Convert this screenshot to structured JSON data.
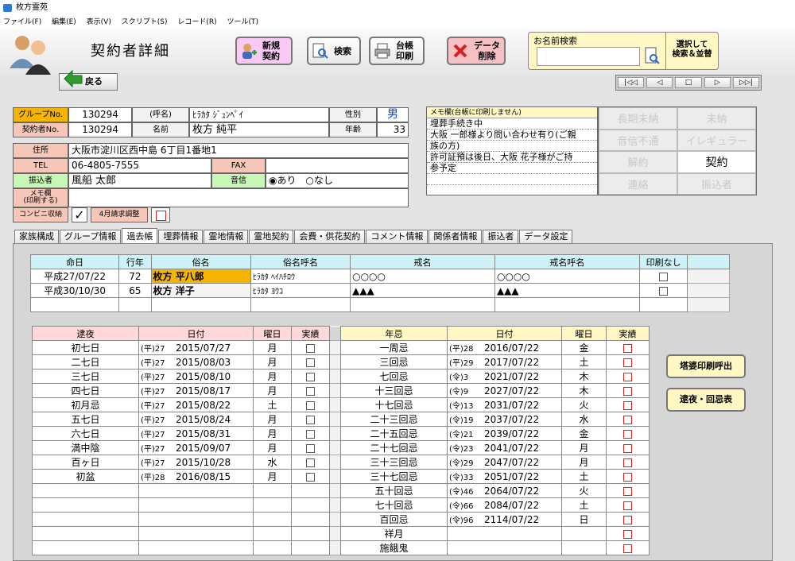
{
  "window": {
    "title": "枚方霊苑"
  },
  "menu": [
    "ファイル(F)",
    "編集(E)",
    "表示(V)",
    "スクリプト(S)",
    "レコード(R)",
    "ツール(T)"
  ],
  "page": {
    "title": "契約者詳細"
  },
  "toolbar": {
    "new_contract": [
      "新規",
      "契約"
    ],
    "search": "検索",
    "ledger_print": [
      "台帳",
      "印刷"
    ],
    "data_delete": [
      "データ",
      "削除"
    ],
    "name_search_label": "お名前検索",
    "name_search_value": "",
    "select_sort": [
      "選択して",
      "検索＆並替"
    ],
    "back": "戻る"
  },
  "contract": {
    "group_label": "グループNo.",
    "group_no": "130294",
    "contract_label": "契約者No.",
    "contract_no": "130294",
    "yomi_label": "(呼名)",
    "yomi": "ﾋﾗｶﾀ ｼﾞｭﾝﾍﾟｲ",
    "name_label": "名前",
    "name": "枚方 純平",
    "gender_label": "性別",
    "gender": "男",
    "age_label": "年齢",
    "age": "33",
    "address_label": "住所",
    "address": "大阪市淀川区西中島 6丁目1番地1",
    "tel_label": "TEL",
    "tel": "06-4805-7555",
    "fax_label": "FAX",
    "fax": "",
    "transfer_label": "振込者",
    "transfer": "風船 太郎",
    "notice_label": "音信",
    "notice_yes": "あり",
    "notice_no": "なし",
    "memo_label": [
      "メモ欄",
      "(印刷する)"
    ],
    "conv_label": "コンビニ収納",
    "april_label": "4月請求調整"
  },
  "memo": {
    "header": "メモ欄(台帳に印刷しません)",
    "lines": [
      "埋葬手続き中",
      "大阪 一郎様より問い合わせ有り(ご親",
      "族の方)",
      "許可証預は後日、大阪 花子様がご持",
      "参予定",
      ""
    ]
  },
  "status": [
    {
      "label": "長期未納",
      "on": false
    },
    {
      "label": "未納",
      "on": false
    },
    {
      "label": "音信不通",
      "on": false
    },
    {
      "label": "イレギュラー",
      "on": false
    },
    {
      "label": "解約",
      "on": false
    },
    {
      "label": "契約",
      "on": true
    },
    {
      "label": "連絡",
      "on": false
    },
    {
      "label": "振込者",
      "on": false
    }
  ],
  "tabs": [
    {
      "label": "家族構成",
      "active": false
    },
    {
      "label": "グループ情報",
      "active": false
    },
    {
      "label": "過去帳",
      "active": true
    },
    {
      "label": "埋葬情報",
      "active": false
    },
    {
      "label": "霊地情報",
      "active": false
    },
    {
      "label": "霊地契約",
      "active": false
    },
    {
      "label": "会費・供花契約",
      "active": false
    },
    {
      "label": "コメント情報",
      "active": false
    },
    {
      "label": "関係者情報",
      "active": false
    },
    {
      "label": "振込者",
      "active": false
    },
    {
      "label": "データ設定",
      "active": false
    }
  ],
  "deceased": {
    "headers": [
      "命日",
      "行年",
      "俗名",
      "俗名呼名",
      "戒名",
      "戒名呼名",
      "印刷なし"
    ],
    "rows": [
      [
        "平成27/07/22",
        "72",
        "枚方 平八郎",
        "ﾋﾗｶﾀ ﾍｲﾊﾁﾛｳ",
        "○○○○",
        "○○○○"
      ],
      [
        "平成30/10/30",
        "65",
        "枚方 洋子",
        "ﾋﾗｶﾀ ﾖｳｺ",
        "▲▲▲",
        "▲▲▲"
      ]
    ]
  },
  "memorial": {
    "headers": [
      "逮夜",
      "日付",
      "曜日",
      "実績"
    ],
    "rows": [
      [
        "初七日",
        "(平)27",
        "2015/07/27",
        "月"
      ],
      [
        "二七日",
        "(平)27",
        "2015/08/03",
        "月"
      ],
      [
        "三七日",
        "(平)27",
        "2015/08/10",
        "月"
      ],
      [
        "四七日",
        "(平)27",
        "2015/08/17",
        "月"
      ],
      [
        "初月忌",
        "(平)27",
        "2015/08/22",
        "土"
      ],
      [
        "五七日",
        "(平)27",
        "2015/08/24",
        "月"
      ],
      [
        "六七日",
        "(平)27",
        "2015/08/31",
        "月"
      ],
      [
        "満中陰",
        "(平)27",
        "2015/09/07",
        "月"
      ],
      [
        "百ヶ日",
        "(平)27",
        "2015/10/28",
        "水"
      ],
      [
        "初盆",
        "(平)28",
        "2016/08/15",
        "月"
      ]
    ]
  },
  "anniversary": {
    "headers": [
      "年忌",
      "日付",
      "曜日",
      "実績"
    ],
    "rows": [
      [
        "一周忌",
        "(平)28",
        "2016/07/22",
        "金"
      ],
      [
        "三回忌",
        "(平)29",
        "2017/07/22",
        "土"
      ],
      [
        "七回忌",
        "(令)3",
        "2021/07/22",
        "木"
      ],
      [
        "十三回忌",
        "(令)9",
        "2027/07/22",
        "木"
      ],
      [
        "十七回忌",
        "(令)13",
        "2031/07/22",
        "火"
      ],
      [
        "二十三回忌",
        "(令)19",
        "2037/07/22",
        "水"
      ],
      [
        "二十五回忌",
        "(令)21",
        "2039/07/22",
        "金"
      ],
      [
        "二十七回忌",
        "(令)23",
        "2041/07/22",
        "月"
      ],
      [
        "三十三回忌",
        "(令)29",
        "2047/07/22",
        "月"
      ],
      [
        "三十七回忌",
        "(令)33",
        "2051/07/22",
        "土"
      ],
      [
        "五十回忌",
        "(令)46",
        "2064/07/22",
        "火"
      ],
      [
        "七十回忌",
        "(令)66",
        "2084/07/22",
        "土"
      ],
      [
        "百回忌",
        "(令)96",
        "2114/07/22",
        "日"
      ],
      [
        "祥月",
        "",
        "",
        ""
      ],
      [
        "施餓鬼",
        "",
        "",
        ""
      ]
    ]
  },
  "side_buttons": {
    "stupa": "塔婆印刷呼出",
    "memorial_table": "逮夜・回忌表"
  },
  "colors": {
    "accent_pink": "#f7c9f3",
    "accent_yellow": "#fff7c4",
    "highlight_gold": "#f4b400",
    "check_red": "#e02020",
    "header_cyan": "#cdf3f8",
    "header_pink": "#ffd9d9",
    "header_yellow": "#fff7c4"
  }
}
